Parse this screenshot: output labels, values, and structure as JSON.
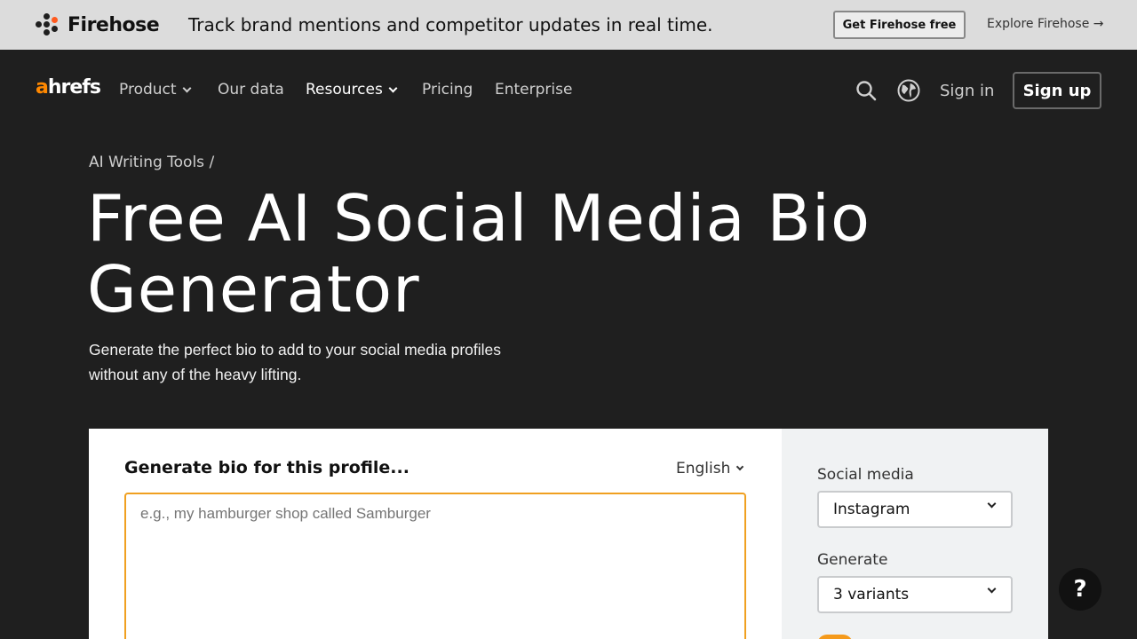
{
  "promo": {
    "brand": "Firehose",
    "text": "Track brand mentions and competitor updates in real time.",
    "cta_label": "Get Firehose free",
    "link_label": "Explore Firehose →",
    "accent": "#ff5a1f"
  },
  "nav": {
    "logo": "ahrefs",
    "logo_accent": "#ff8800",
    "items": [
      {
        "label": "Product",
        "has_caret": true
      },
      {
        "label": "Our data",
        "has_caret": false
      },
      {
        "label": "Resources",
        "has_caret": true
      },
      {
        "label": "Pricing",
        "has_caret": false
      },
      {
        "label": "Enterprise",
        "has_caret": false
      }
    ],
    "icons": [
      "search-icon",
      "globe-icon"
    ],
    "signin_label": "Sign in",
    "signup_label": "Sign up"
  },
  "hero": {
    "breadcrumb": "AI Writing Tools /",
    "title": "Free AI Social Media Bio Generator",
    "subtitle": "Generate the perfect bio to add to your social media profiles without any of the heavy lifting."
  },
  "form": {
    "title": "Generate bio for this profile...",
    "language": "English",
    "prompt_placeholder": "e.g., my hamburger shop called Samburger",
    "prompt_value": "",
    "focus_color": "#f0a020"
  },
  "settings": {
    "social_media_label": "Social media",
    "social_media_value": "Instagram",
    "generate_label": "Generate",
    "generate_value": "3 variants",
    "toggle_color": "#f59a1b"
  },
  "help": {
    "label": "?"
  }
}
